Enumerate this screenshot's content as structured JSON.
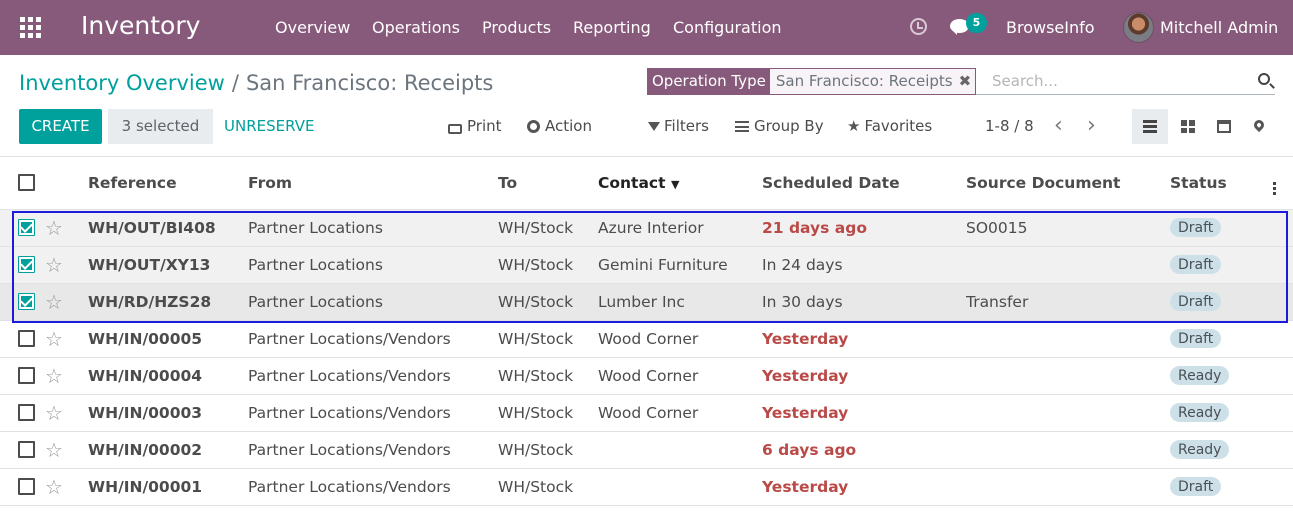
{
  "topbar": {
    "app_title": "Inventory",
    "menu": [
      "Overview",
      "Operations",
      "Products",
      "Reporting",
      "Configuration"
    ],
    "notifications_count": "5",
    "company": "BrowseInfo",
    "user_name": "Mitchell Admin",
    "color": "#875a7b"
  },
  "breadcrumb": {
    "parent": "Inventory Overview",
    "separator": "/",
    "current": "San Francisco: Receipts"
  },
  "search": {
    "facet_label": "Operation Type",
    "facet_value": "San Francisco: Receipts",
    "placeholder": "Search..."
  },
  "toolbar": {
    "create_label": "CREATE",
    "selected_label": "3 selected",
    "unreserve_label": "UNRESERVE",
    "print_label": "Print",
    "action_label": "Action",
    "filters_label": "Filters",
    "group_by_label": "Group By",
    "favorites_label": "Favorites",
    "pager": "1-8 / 8"
  },
  "accent_color": "#00a09d",
  "table": {
    "columns": [
      "Reference",
      "From",
      "To",
      "Contact",
      "Scheduled Date",
      "Source Document",
      "Status"
    ],
    "sorted_column": "Contact",
    "rows": [
      {
        "checked": true,
        "reference": "WH/OUT/BI408",
        "from": "Partner Locations",
        "to": "WH/Stock",
        "contact": "Azure Interior",
        "scheduled": "21 days ago",
        "late": true,
        "source": "SO0015",
        "status": "Draft"
      },
      {
        "checked": true,
        "reference": "WH/OUT/XY13",
        "from": "Partner Locations",
        "to": "WH/Stock",
        "contact": "Gemini Furniture",
        "scheduled": "In 24 days",
        "late": false,
        "source": "",
        "status": "Draft"
      },
      {
        "checked": true,
        "reference": "WH/RD/HZS28",
        "from": "Partner Locations",
        "to": "WH/Stock",
        "contact": "Lumber Inc",
        "scheduled": "In 30 days",
        "late": false,
        "source": "Transfer",
        "status": "Draft"
      },
      {
        "checked": false,
        "reference": "WH/IN/00005",
        "from": "Partner Locations/Vendors",
        "to": "WH/Stock",
        "contact": "Wood Corner",
        "scheduled": "Yesterday",
        "late": true,
        "source": "",
        "status": "Draft"
      },
      {
        "checked": false,
        "reference": "WH/IN/00004",
        "from": "Partner Locations/Vendors",
        "to": "WH/Stock",
        "contact": "Wood Corner",
        "scheduled": "Yesterday",
        "late": true,
        "source": "",
        "status": "Ready"
      },
      {
        "checked": false,
        "reference": "WH/IN/00003",
        "from": "Partner Locations/Vendors",
        "to": "WH/Stock",
        "contact": "Wood Corner",
        "scheduled": "Yesterday",
        "late": true,
        "source": "",
        "status": "Ready"
      },
      {
        "checked": false,
        "reference": "WH/IN/00002",
        "from": "Partner Locations/Vendors",
        "to": "WH/Stock",
        "contact": "",
        "scheduled": "6 days ago",
        "late": true,
        "source": "",
        "status": "Ready"
      },
      {
        "checked": false,
        "reference": "WH/IN/00001",
        "from": "Partner Locations/Vendors",
        "to": "WH/Stock",
        "contact": "",
        "scheduled": "Yesterday",
        "late": true,
        "source": "",
        "status": "Draft"
      }
    ]
  }
}
